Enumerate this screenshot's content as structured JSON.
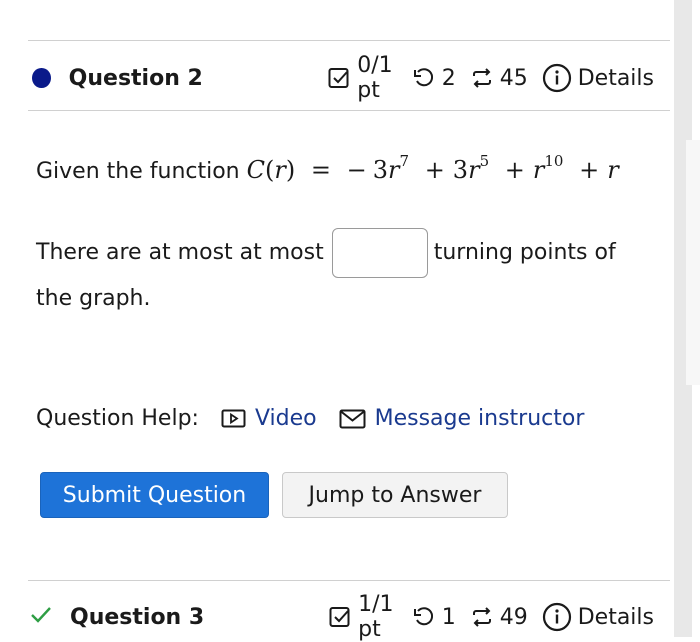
{
  "question2": {
    "title": "Question 2",
    "score": "0/1 pt",
    "retries": "2",
    "attempts": "45",
    "details_label": "Details"
  },
  "stem": {
    "prefix": "Given the function",
    "fn_name": "C",
    "fn_var": "r",
    "eq": "=",
    "minus": "−",
    "t1_coef": "3",
    "t1_exp": "7",
    "plus1": "+",
    "t2_coef": "3",
    "t2_exp": "5",
    "plus2": "+",
    "t3_exp": "10",
    "plus3": "+",
    "t4": "r"
  },
  "prompt": {
    "before": "There are at most at most",
    "answer_value": "",
    "after": "turning points of the graph."
  },
  "help": {
    "label": "Question Help:",
    "video": "Video",
    "message": "Message instructor"
  },
  "buttons": {
    "submit": "Submit Question",
    "jump": "Jump to Answer"
  },
  "question3": {
    "title": "Question 3",
    "score": "1/1 pt",
    "retries": "1",
    "attempts": "49",
    "details_label": "Details"
  },
  "icons": {
    "bullet_color": "#0a1a8a",
    "check_color": "#2e9e44",
    "link_color": "#1a3a8f",
    "primary_color": "#1e73d8"
  }
}
